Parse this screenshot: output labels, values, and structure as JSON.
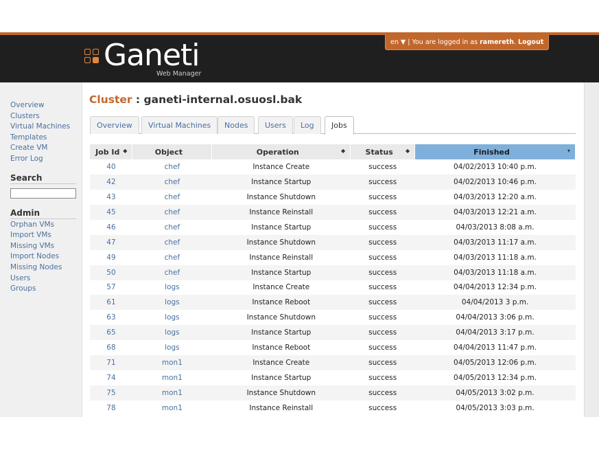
{
  "header": {
    "logo_text": "Ganeti",
    "logo_subtitle": "Web Manager",
    "lang": "en ▼",
    "login_prefix": " | You are logged in as ",
    "username": "ramereth",
    "login_sep": ". ",
    "logout_label": "Logout",
    "accent": "#c2672c",
    "bar_color": "#1f1f1f"
  },
  "sidebar": {
    "nav": [
      "Overview",
      "Clusters",
      "Virtual Machines",
      "Templates",
      "Create VM",
      "Error Log"
    ],
    "search_heading": "Search",
    "search_value": "",
    "admin_heading": "Admin",
    "admin": [
      "Orphan VMs",
      "Import VMs",
      "Missing VMs",
      "Import Nodes",
      "Missing Nodes",
      "Users",
      "Groups"
    ]
  },
  "page": {
    "title_prefix": "Cluster",
    "title_sep": " : ",
    "cluster_name": "ganeti-internal.osuosl.bak"
  },
  "tabs": [
    "Overview",
    "Virtual Machines",
    "Nodes",
    "Users",
    "Log",
    "Jobs"
  ],
  "active_tab": "Jobs",
  "table": {
    "columns": [
      "Job Id",
      "Object",
      "Operation",
      "Status",
      "Finished"
    ],
    "sort_glyph": "◆",
    "sorted_glyph": "▾",
    "sorted_column": "Finished",
    "rows": [
      [
        "40",
        "chef",
        "Instance Create",
        "success",
        "04/02/2013 10:40 p.m."
      ],
      [
        "42",
        "chef",
        "Instance Startup",
        "success",
        "04/02/2013 10:46 p.m."
      ],
      [
        "43",
        "chef",
        "Instance Shutdown",
        "success",
        "04/03/2013 12:20 a.m."
      ],
      [
        "45",
        "chef",
        "Instance Reinstall",
        "success",
        "04/03/2013 12:21 a.m."
      ],
      [
        "46",
        "chef",
        "Instance Startup",
        "success",
        "04/03/2013 8:08 a.m."
      ],
      [
        "47",
        "chef",
        "Instance Shutdown",
        "success",
        "04/03/2013 11:17 a.m."
      ],
      [
        "49",
        "chef",
        "Instance Reinstall",
        "success",
        "04/03/2013 11:18 a.m."
      ],
      [
        "50",
        "chef",
        "Instance Startup",
        "success",
        "04/03/2013 11:18 a.m."
      ],
      [
        "57",
        "logs",
        "Instance Create",
        "success",
        "04/04/2013 12:34 p.m."
      ],
      [
        "61",
        "logs",
        "Instance Reboot",
        "success",
        "04/04/2013 3 p.m."
      ],
      [
        "63",
        "logs",
        "Instance Shutdown",
        "success",
        "04/04/2013 3:06 p.m."
      ],
      [
        "65",
        "logs",
        "Instance Startup",
        "success",
        "04/04/2013 3:17 p.m."
      ],
      [
        "68",
        "logs",
        "Instance Reboot",
        "success",
        "04/04/2013 11:47 p.m."
      ],
      [
        "71",
        "mon1",
        "Instance Create",
        "success",
        "04/05/2013 12:06 p.m."
      ],
      [
        "74",
        "mon1",
        "Instance Startup",
        "success",
        "04/05/2013 12:34 p.m."
      ],
      [
        "75",
        "mon1",
        "Instance Shutdown",
        "success",
        "04/05/2013 3:02 p.m."
      ],
      [
        "78",
        "mon1",
        "Instance Reinstall",
        "success",
        "04/05/2013 3:03 p.m."
      ]
    ]
  }
}
